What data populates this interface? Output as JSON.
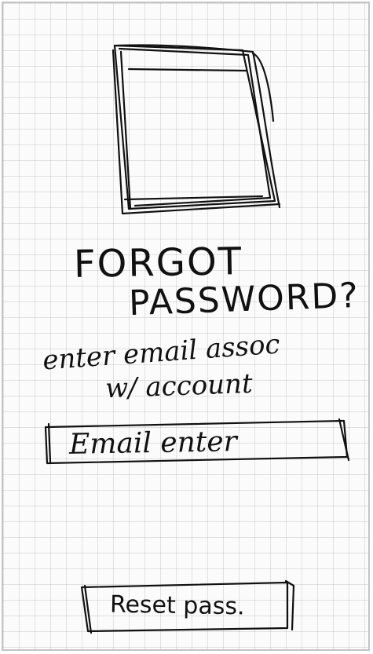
{
  "screen": {
    "title_line_1": "FORGOT",
    "title_line_2": "PASSWORD?",
    "instruction_line_1": "enter email assoc",
    "instruction_line_2": "w/ account",
    "email_placeholder": "Email enter",
    "reset_label": "Reset pass."
  },
  "image_placeholder": {
    "icon": "image-placeholder-icon"
  }
}
